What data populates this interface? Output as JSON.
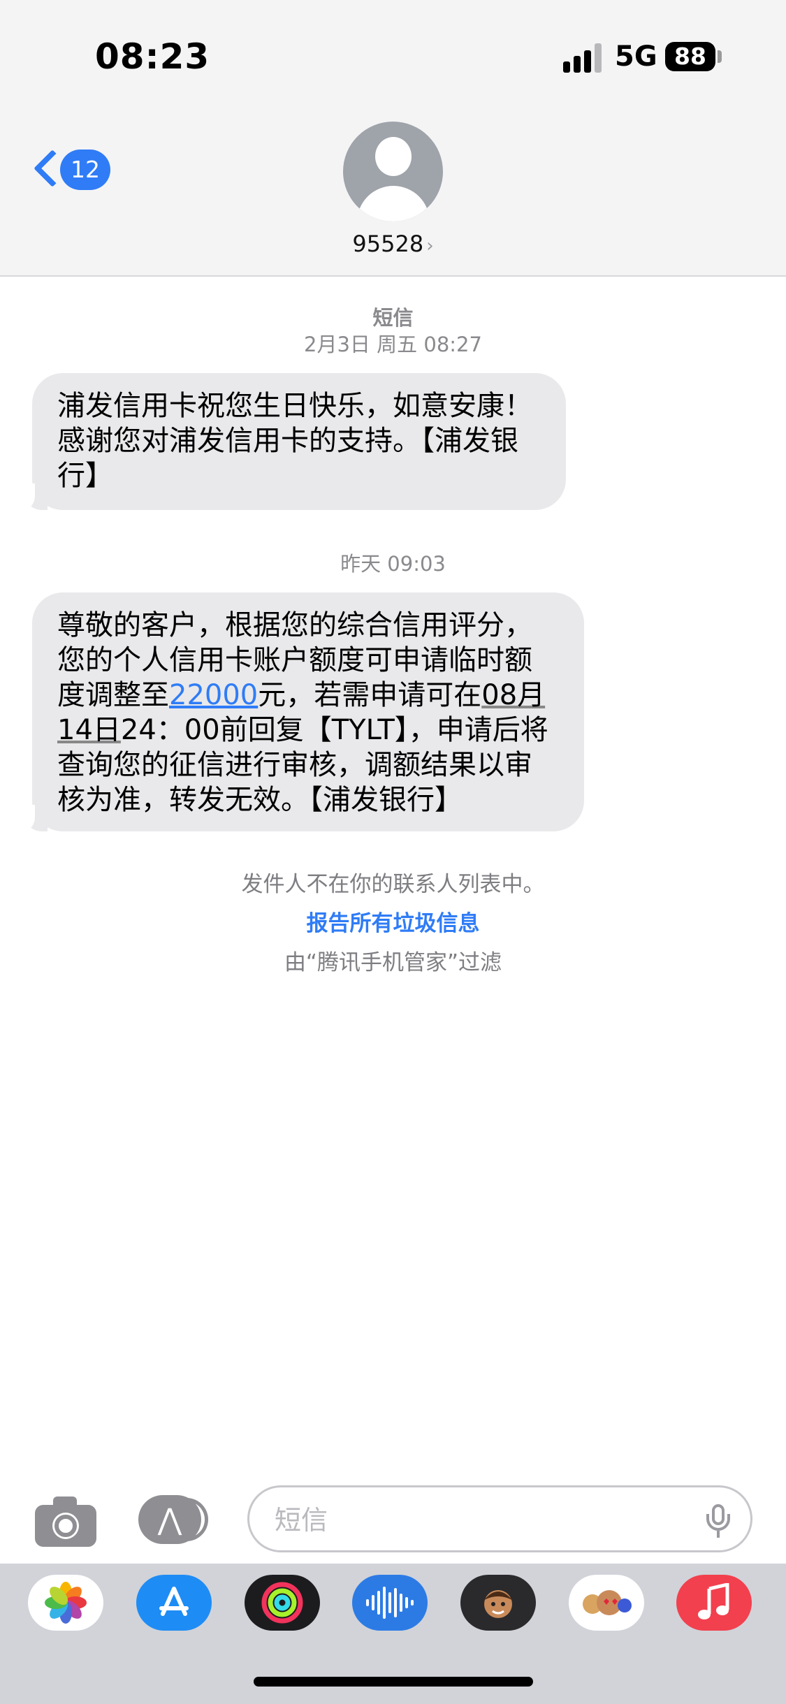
{
  "status_bar": {
    "time": "08:23",
    "network": "5G",
    "battery": "88"
  },
  "header": {
    "back_count": "12",
    "contact": "95528",
    "contact_chevron": "›"
  },
  "messages": [
    {
      "service": "短信",
      "timestamp": "2月3日 周五 08:27",
      "lines": [
        "浦发信用卡祝您生日快乐，如意安康！",
        "感谢您对浦发信用卡的支持。【浦发银",
        "行】"
      ]
    },
    {
      "timestamp": "昨天 09:03",
      "text_parts": {
        "l1": "尊敬的客户，根据您的综合信用评分，",
        "l2": "您的个人信用卡账户额度可申请临时额",
        "l3a": "度调整至",
        "amount": "22000",
        "l3b": "元，若需申请可在",
        "date1": "08月",
        "date2": "14日",
        "l4": "24：00前回复【TYLT】，申请后将",
        "l5": "查询您的征信进行审核，调额结果以审",
        "l6": "核为准，转发无效。【浦发银行】"
      }
    }
  ],
  "notice": {
    "not_in_contacts": "发件人不在你的联系人列表中。",
    "report_junk": "报告所有垃圾信息",
    "filtered_by": "由“腾讯手机管家”过滤"
  },
  "composer": {
    "placeholder": "短信"
  },
  "app_tray": [
    {
      "name": "photos",
      "color": "#ffffff"
    },
    {
      "name": "app-store",
      "color": "#1e8cf5"
    },
    {
      "name": "fitness",
      "color": "#1c1c1e"
    },
    {
      "name": "audio-message",
      "color": "#2c7be5"
    },
    {
      "name": "memoji",
      "color": "#2a2a2c"
    },
    {
      "name": "memoji-stickers",
      "color": "#ffffff"
    },
    {
      "name": "music",
      "color": "#f2404e"
    }
  ]
}
